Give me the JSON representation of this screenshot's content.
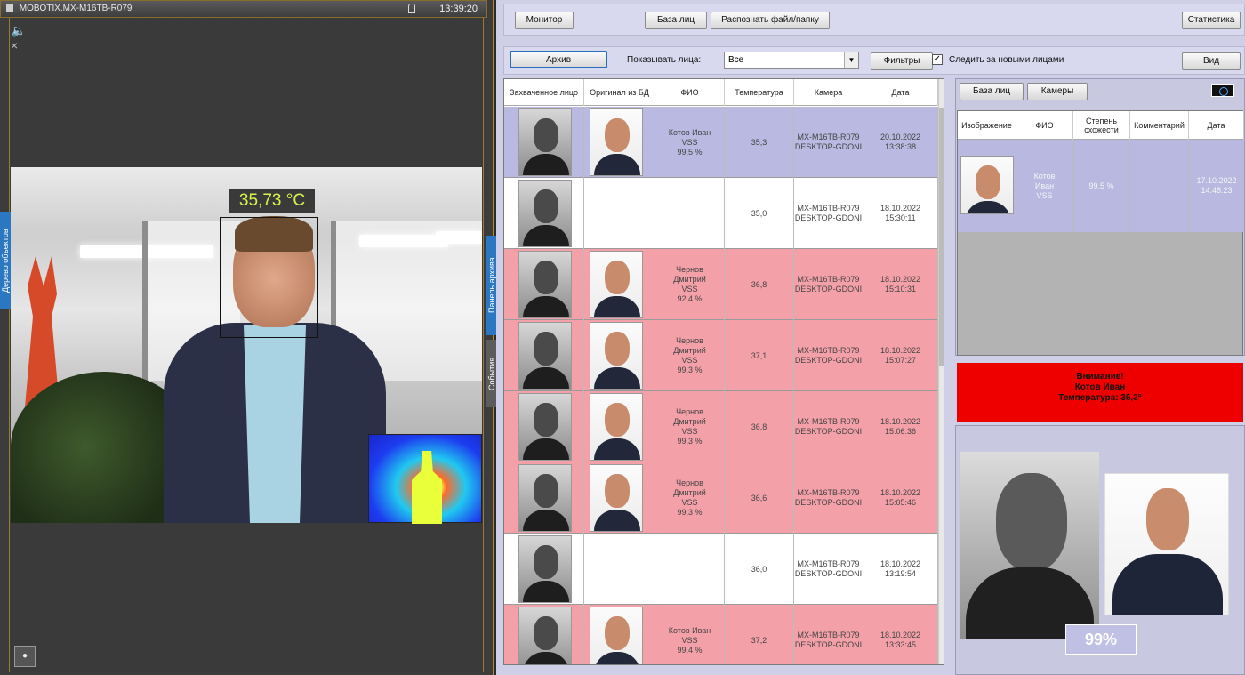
{
  "camera": {
    "title": "MOBOTIX.MX-M16TB-R079",
    "time": "13:39:20",
    "temperature_overlay": "35,73 °C",
    "side_tabs": {
      "objects": "Дерево объектов",
      "archive": "Панель архива",
      "events": "События"
    }
  },
  "toolbar": {
    "monitor": "Монитор",
    "face_db": "База лиц",
    "recognize": "Распознать файл/папку",
    "stats": "Статистика"
  },
  "archive_bar": {
    "archive": "Архив",
    "show_faces_label": "Показывать лица:",
    "show_faces_value": "Все",
    "filters": "Фильтры",
    "follow_label": "Следить за новыми лицами",
    "follow_checked": "✓",
    "view": "Вид"
  },
  "events_table": {
    "headers": [
      "Захваченное лицо",
      "Оригинал из БД",
      "ФИО",
      "Температура",
      "Камера",
      "Дата"
    ],
    "rows": [
      {
        "fio": "Котов Иван\nVSS\n99,5 %",
        "temp": "35,3",
        "camera": "MX-M16TB-R079\nDESKTOP-GDONI",
        "date": "20.10.2022\n13:38:38",
        "status": "selected",
        "has_db": true
      },
      {
        "fio": "",
        "temp": "35,0",
        "camera": "MX-M16TB-R079\nDESKTOP-GDONI",
        "date": "18.10.2022\n15:30:11",
        "status": "normal",
        "has_db": false
      },
      {
        "fio": "Чернов\nДмитрий\nVSS\n92,4 %",
        "temp": "36,8",
        "camera": "MX-M16TB-R079\nDESKTOP-GDONI",
        "date": "18.10.2022\n15:10:31",
        "status": "alert",
        "has_db": true
      },
      {
        "fio": "Чернов\nДмитрий\nVSS\n99,3 %",
        "temp": "37,1",
        "camera": "MX-M16TB-R079\nDESKTOP-GDONI",
        "date": "18.10.2022\n15:07:27",
        "status": "alert",
        "has_db": true
      },
      {
        "fio": "Чернов\nДмитрий\nVSS\n99,3 %",
        "temp": "36,8",
        "camera": "MX-M16TB-R079\nDESKTOP-GDONI",
        "date": "18.10.2022\n15:06:36",
        "status": "alert",
        "has_db": true
      },
      {
        "fio": "Чернов\nДмитрий\nVSS\n99,3 %",
        "temp": "36,6",
        "camera": "MX-M16TB-R079\nDESKTOP-GDONI",
        "date": "18.10.2022\n15:05:46",
        "status": "alert",
        "has_db": true
      },
      {
        "fio": "",
        "temp": "36,0",
        "camera": "MX-M16TB-R079\nDESKTOP-GDONI",
        "date": "18.10.2022\n13:19:54",
        "status": "normal",
        "has_db": false
      },
      {
        "fio": "Котов Иван\nVSS\n99,4 %",
        "temp": "37,2",
        "camera": "MX-M16TB-R079\nDESKTOP-GDONI",
        "date": "18.10.2022\n13:33:45",
        "status": "alert",
        "has_db": true
      }
    ]
  },
  "db_panel": {
    "face_db": "База лиц",
    "cameras": "Камеры",
    "headers": [
      "Изображение",
      "ФИО",
      "Степень схожести",
      "Комментарий",
      "Дата"
    ],
    "row": {
      "fio": "Котов\nИван\nVSS",
      "similarity": "99,5 %",
      "comment": "",
      "date": "17.10.2022\n14:48:23"
    }
  },
  "alert": {
    "line1": "Внимание!",
    "line2": "Котов Иван",
    "line3": "Температура: 35,3°"
  },
  "compare": {
    "similarity": "99%"
  },
  "colors": {
    "selected_row": "#b9b9e2",
    "alert_row": "#f4a0a8",
    "normal_row": "#ffffff",
    "alert_bg": "#ee0000",
    "app_bg": "#cfcfe8"
  }
}
